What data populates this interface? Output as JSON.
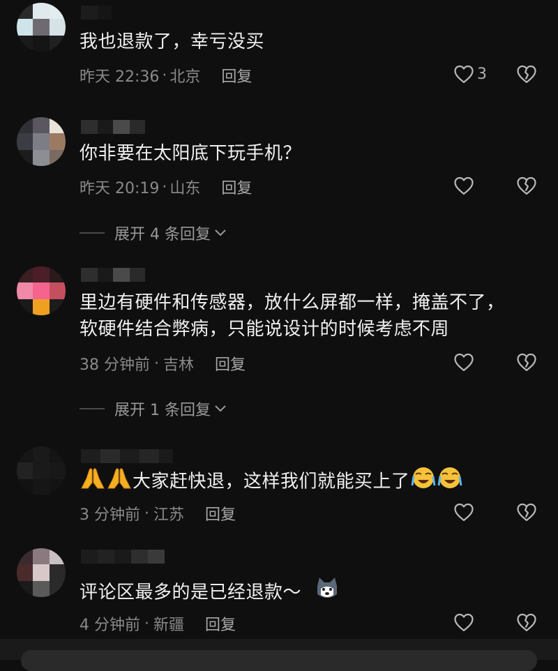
{
  "comments": [
    {
      "text": "我也退款了，幸亏没买",
      "time": "昨天 22:36",
      "location": "北京",
      "reply": "回复",
      "likes": "3"
    },
    {
      "text": "你非要在太阳底下玩手机？",
      "time": "昨天 20:19",
      "location": "山东",
      "reply": "回复",
      "likes": "",
      "expand": "展开 4 条回复"
    },
    {
      "text_line1": "里边有硬件和传感器，放什么屏都一样，掩盖不了，",
      "text_line2": "软硬件结合弊病，只能说设计的时候考虑不周",
      "time": "38 分钟前",
      "location": "吉林",
      "reply": "回复",
      "likes": "",
      "expand": "展开 1 条回复"
    },
    {
      "text": "大家赶快退，这样我们就能买上了",
      "time": "3 分钟前",
      "location": "江苏",
      "reply": "回复",
      "likes": ""
    },
    {
      "text": "评论区最多的是已经退款～",
      "time": "4 分钟前",
      "location": "新疆",
      "reply": "回复",
      "likes": ""
    }
  ],
  "separator": "·",
  "icons": {
    "like": "heart-outline-icon",
    "dislike": "broken-heart-icon",
    "expand": "chevron-down-icon",
    "emoji_pray": "folded-hands-emoji",
    "emoji_cry": "loudly-crying-face-emoji",
    "emoji_dog": "husky-emoji"
  },
  "colors": {
    "background": "#0f0f0f",
    "text": "#f0f0f0",
    "meta": "#8a8a8a"
  }
}
